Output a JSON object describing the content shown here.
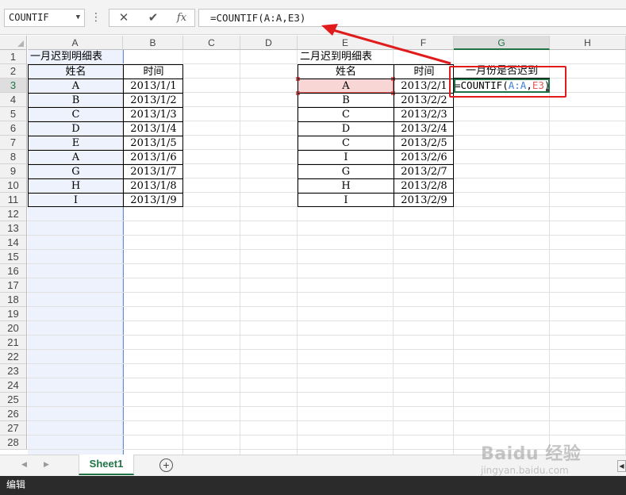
{
  "formula_bar": {
    "name_box": "COUNTIF",
    "name_box_dropdown_icon": "chevron-down-icon",
    "more_icon": "vertical-dots-icon",
    "cancel_icon": "close-icon",
    "enter_icon": "check-icon",
    "fx_label": "fx",
    "formula": "=COUNTIF(A:A,E3)"
  },
  "columns": [
    "A",
    "B",
    "C",
    "D",
    "E",
    "F",
    "G",
    "H"
  ],
  "selected_column": "G",
  "rows": [
    "1",
    "2",
    "3",
    "4",
    "5",
    "6",
    "7",
    "8",
    "9",
    "10",
    "11",
    "12",
    "13",
    "14",
    "15",
    "16",
    "17",
    "18",
    "19",
    "20",
    "21",
    "22",
    "23",
    "24",
    "25",
    "26",
    "27",
    "28"
  ],
  "selected_row": "3",
  "jan_table": {
    "title": "一月迟到明细表",
    "header_name": "姓名",
    "header_time": "时间",
    "names": [
      "A",
      "B",
      "C",
      "D",
      "E",
      "A",
      "G",
      "H",
      "I"
    ],
    "dates": [
      "2013/1/1",
      "2013/1/2",
      "2013/1/3",
      "2013/1/4",
      "2013/1/5",
      "2013/1/6",
      "2013/1/7",
      "2013/1/8",
      "2013/1/9"
    ]
  },
  "feb_table": {
    "title": "二月迟到明细表",
    "header_name": "姓名",
    "header_time": "时间",
    "names": [
      "A",
      "B",
      "C",
      "D",
      "C",
      "I",
      "G",
      "H",
      "I"
    ],
    "dates": [
      "2013/2/1",
      "2013/2/2",
      "2013/2/3",
      "2013/2/4",
      "2013/2/5",
      "2013/2/6",
      "2013/2/7",
      "2013/2/8",
      "2013/2/9"
    ]
  },
  "g_column": {
    "header": "一月份是否迟到",
    "edit_prefix": "=COUNTIF(",
    "edit_ref_a": "A:A",
    "edit_comma": ",",
    "edit_ref_e": "E3",
    "edit_suffix": ")"
  },
  "sheet_tabs": {
    "prev_icon": "triangle-left-icon",
    "next_icon": "triangle-right-icon",
    "active_tab": "Sheet1",
    "add_icon": "plus-circle-icon"
  },
  "status_bar": {
    "mode": "编辑"
  },
  "watermark": {
    "logo": "Baidu 经验",
    "url": "jingyan.baidu.com"
  },
  "colors": {
    "excel_green": "#217346",
    "ref_blue": "#3d7fd8",
    "ref_red": "#e05a5a",
    "annotation_red": "#e01b1b"
  }
}
